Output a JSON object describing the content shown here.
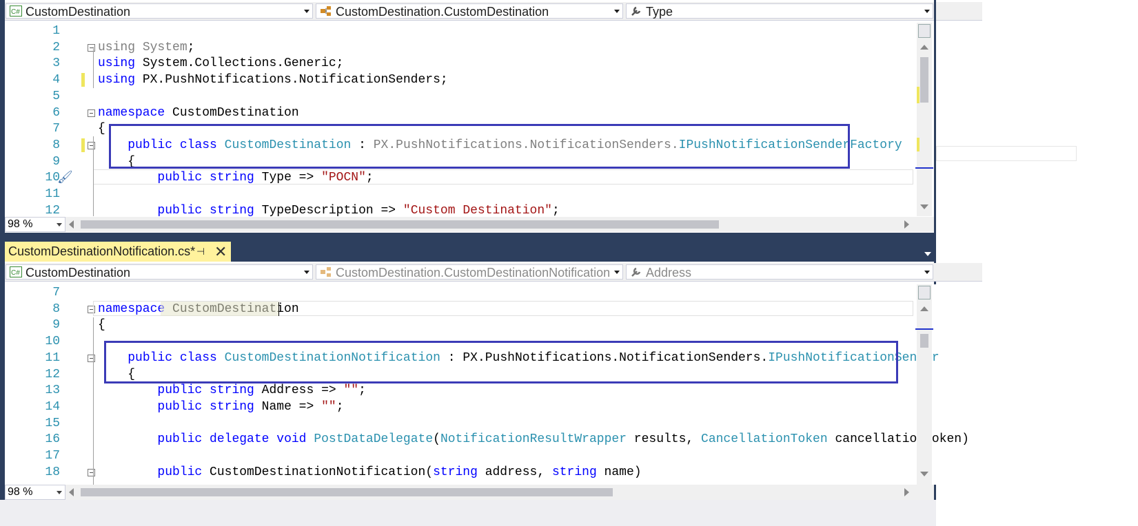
{
  "top_pane": {
    "nav": {
      "project": "CustomDestination",
      "class": "CustomDestination.CustomDestination",
      "member": "Type"
    },
    "zoom": "98 %",
    "lines": [
      {
        "n": "1",
        "code": ""
      },
      {
        "n": "2",
        "code": "using System;"
      },
      {
        "n": "3",
        "code": "using System.Collections.Generic;"
      },
      {
        "n": "4",
        "code": "using PX.PushNotifications.NotificationSenders;"
      },
      {
        "n": "5",
        "code": ""
      },
      {
        "n": "6",
        "code": "namespace CustomDestination"
      },
      {
        "n": "7",
        "code": "{"
      },
      {
        "n": "8",
        "code": "    public class CustomDestination : PX.PushNotifications.NotificationSenders.IPushNotificationSenderFactory"
      },
      {
        "n": "9",
        "code": "    {"
      },
      {
        "n": "10",
        "code": "        public string Type => \"POCN\";"
      },
      {
        "n": "11",
        "code": ""
      },
      {
        "n": "12",
        "code": "        public string TypeDescription => \"Custom Destination\";"
      }
    ]
  },
  "bottom_pane": {
    "tab": {
      "title": "CustomDestinationNotification.cs*",
      "pin_icon": "pin-icon",
      "close_icon": "close-icon"
    },
    "nav": {
      "project": "CustomDestination",
      "class": "CustomDestination.CustomDestinationNotification",
      "member": "Address"
    },
    "zoom": "98 %",
    "lines": [
      {
        "n": "7",
        "code": ""
      },
      {
        "n": "8",
        "code": "namespace CustomDestination"
      },
      {
        "n": "9",
        "code": "{"
      },
      {
        "n": "10",
        "code": ""
      },
      {
        "n": "11",
        "code": "    public class CustomDestinationNotification : PX.PushNotifications.NotificationSenders.IPushNotificationSender"
      },
      {
        "n": "12",
        "code": "    {"
      },
      {
        "n": "13",
        "code": "        public string Address => \"\";"
      },
      {
        "n": "14",
        "code": "        public string Name => \"\";"
      },
      {
        "n": "15",
        "code": ""
      },
      {
        "n": "16",
        "code": "        public delegate void PostDataDelegate(NotificationResultWrapper results, CancellationToken cancellationToken);"
      },
      {
        "n": "17",
        "code": ""
      },
      {
        "n": "18",
        "code": "        public CustomDestinationNotification(string address, string name)"
      }
    ]
  },
  "colors": {
    "keyword": "#0000ff",
    "type": "#2b91af",
    "string": "#a31515",
    "highlight_box": "#3b3bb7",
    "tab_active": "#fff29d",
    "tab_strip": "#2d3f5e"
  }
}
